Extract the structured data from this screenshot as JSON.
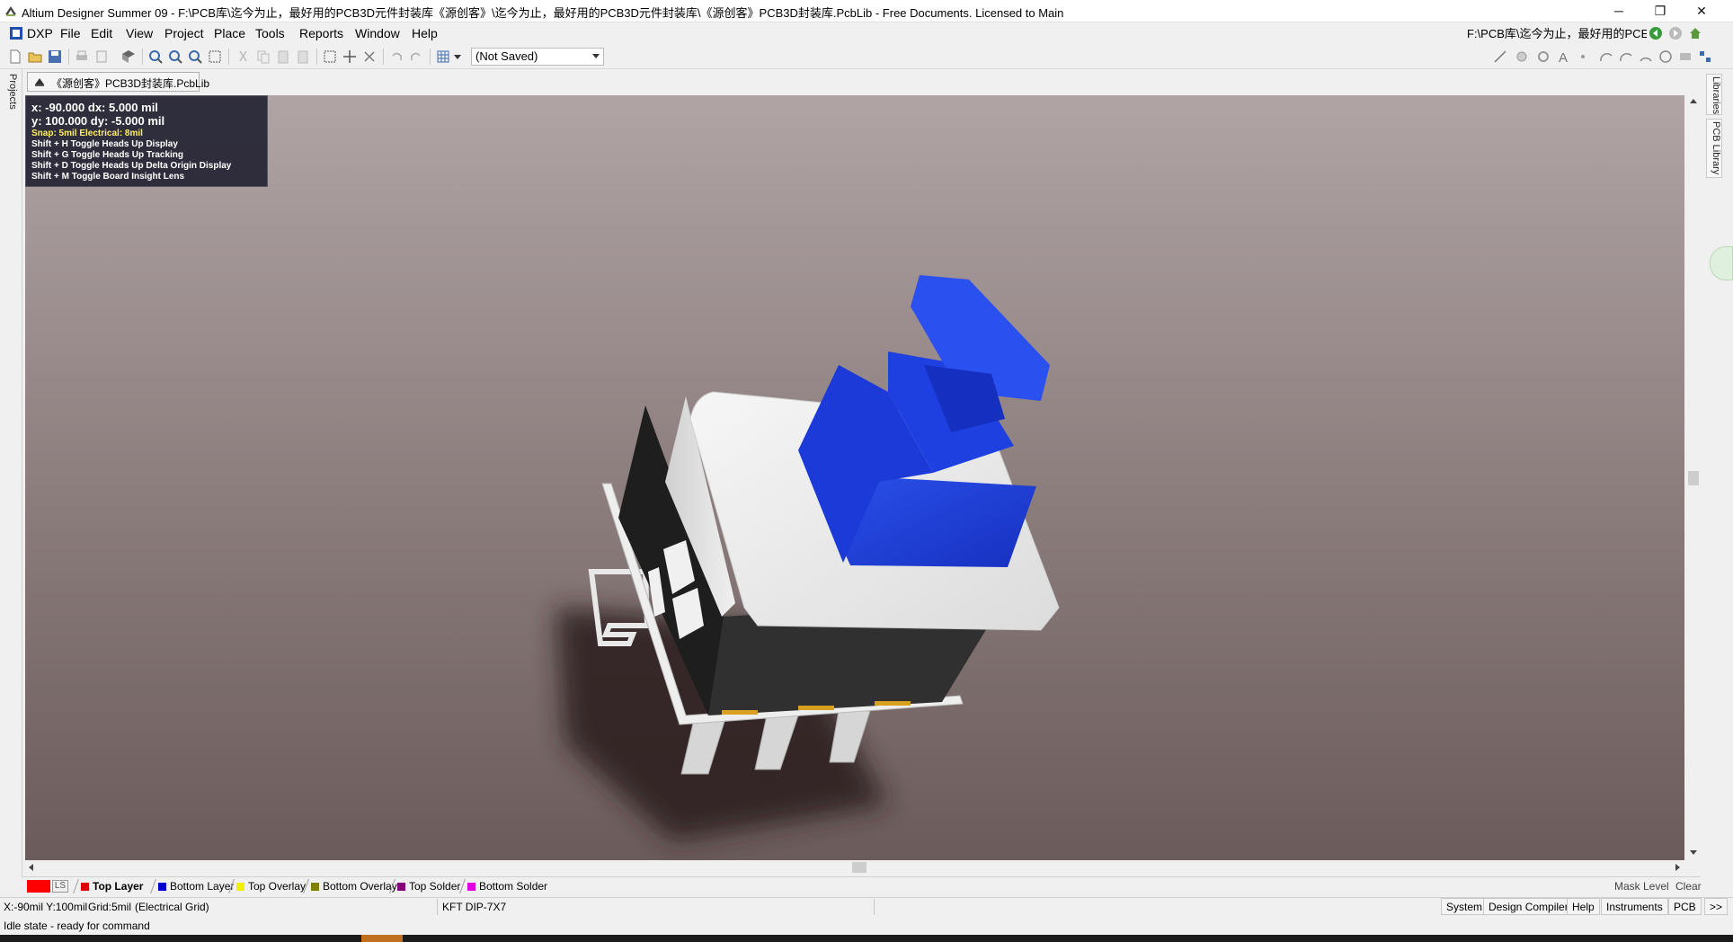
{
  "window": {
    "title": "Altium Designer Summer 09 - F:\\PCB库\\迄今为止，最好用的PCB3D元件封装库《源创客》\\迄今为止，最好用的PCB3D元件封装库\\《源创客》PCB3D封装库.PcbLib - Free Documents. Licensed to Main",
    "minimize": "─",
    "restore": "❐",
    "close": "✕"
  },
  "menu": {
    "dxp": "DXP",
    "file": "File",
    "edit": "Edit",
    "view": "View",
    "project": "Project",
    "place": "Place",
    "tools": "Tools",
    "reports": "Reports",
    "window": "Window",
    "help": "Help",
    "path": "F:\\PCB库\\迄今为止，最好用的PCE"
  },
  "toolbar": {
    "not_saved": "(Not Saved)"
  },
  "panels": {
    "projects": "Projects",
    "libraries": "Libraries",
    "pcb_library": "PCB Library"
  },
  "document_tab": "《源创客》PCB3D封装库.PcbLib",
  "hud": {
    "line1": "x:   -90.000    dx:     5.000  mil",
    "line2": "y:   100.000    dy:    -5.000  mil",
    "snap": "Snap: 5mil Electrical: 8mil",
    "h": "Shift + H  Toggle Heads Up Display",
    "g": "Shift + G  Toggle Heads Up Tracking",
    "d": "Shift + D  Toggle Heads Up Delta Origin Display",
    "m": "Shift + M  Toggle Board Insight Lens"
  },
  "layers": {
    "ls": "LS",
    "items": [
      {
        "label": "Top Layer",
        "color": "#e00000"
      },
      {
        "label": "Bottom Layer",
        "color": "#0000d0"
      },
      {
        "label": "Top Overlay",
        "color": "#f0f000"
      },
      {
        "label": "Bottom Overlay",
        "color": "#808000"
      },
      {
        "label": "Top Solder",
        "color": "#800080"
      },
      {
        "label": "Bottom Solder",
        "color": "#e000e0"
      }
    ],
    "mask_level": "Mask Level",
    "clear": "Clear"
  },
  "status": {
    "coords": "X:-90mil Y:100mil",
    "grid": "Grid:5mil",
    "grid_type": "(Electrical Grid)",
    "component": "KFT DIP-7X7",
    "idle": "Idle state - ready for command",
    "buttons": [
      "System",
      "Design Compiler",
      "Help",
      "Instruments",
      "PCB",
      ">>"
    ]
  }
}
